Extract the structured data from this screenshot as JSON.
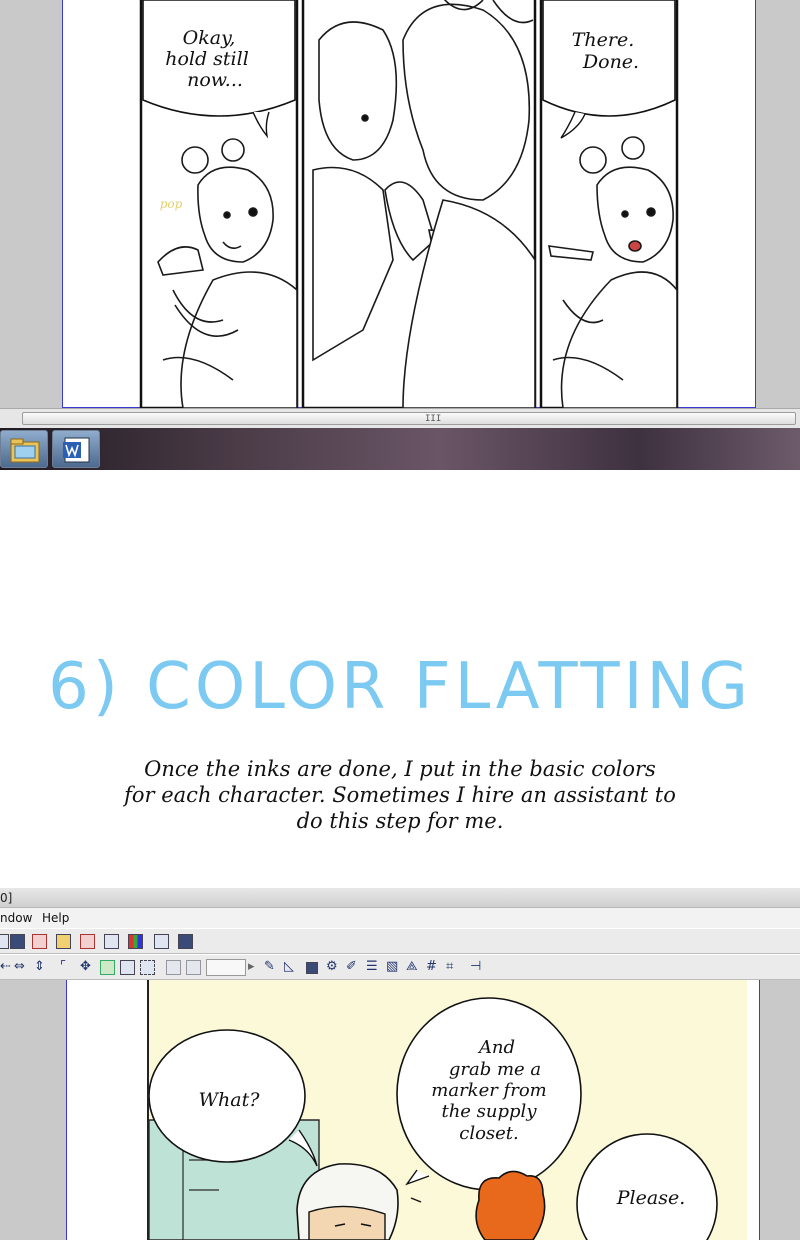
{
  "top_screenshot": {
    "panel1_bubble": [
      "Okay,",
      "hold still",
      "now..."
    ],
    "panel1_sfx": "pop",
    "panel3_bubble": [
      "There.",
      "Done."
    ],
    "scrollbar_grip": "III"
  },
  "section": {
    "title": "6) COLOR FLATTING",
    "accent_color": "#7cc9f1",
    "body_lines": [
      "Once the inks are done, I put in the basic colors",
      "for each character. Sometimes I hire an assistant to",
      "do this step for me."
    ]
  },
  "bottom_screenshot": {
    "title_fragment": "0]",
    "menu": {
      "window_label": "ndow",
      "help_label": "Help"
    },
    "bubbles": {
      "left": [
        "What?"
      ],
      "middle": [
        "And",
        "grab me a",
        "marker from",
        "the supply",
        "closet."
      ],
      "right": [
        "Please."
      ]
    },
    "panel_color": "#fbf9d8"
  },
  "icons": [
    "file-explorer-icon",
    "word-icon",
    "pen-tool-icon",
    "ruler-tool-icon",
    "grid-icon",
    "play-icon"
  ]
}
